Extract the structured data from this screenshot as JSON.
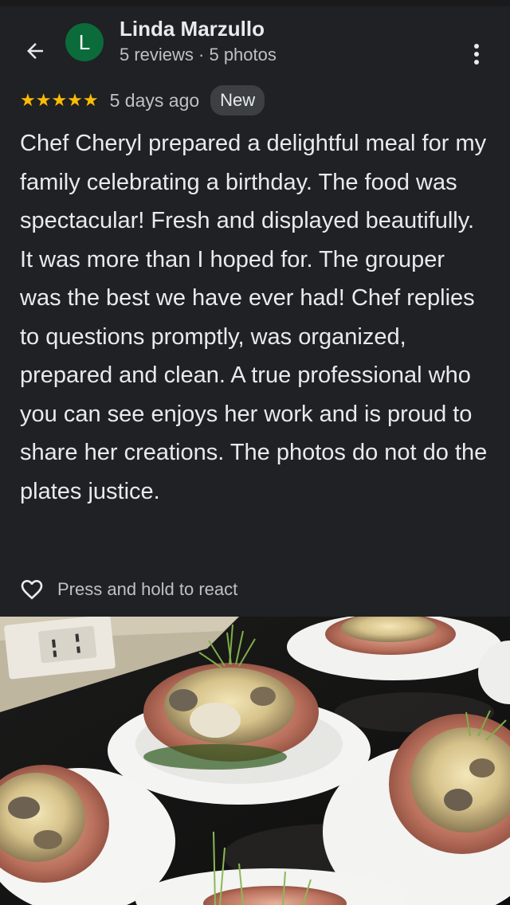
{
  "reviewer": {
    "avatar_letter": "L",
    "name": "Linda Marzullo",
    "meta": "5 reviews · 5 photos"
  },
  "review": {
    "stars": "★★★★★",
    "rating": 5,
    "time_ago": "5 days ago",
    "badge": "New",
    "text": "Chef Cheryl prepared a delightful meal for my family celebrating a birthday. The food was spectacular! Fresh and displayed beautifully. It was more than I hoped for. The grouper was the best we have ever had! Chef replies to questions promptly, was organized, prepared and clean. A true professional who you can see enjoys her work and is proud to share her creations. The photos do not do the plates justice."
  },
  "react": {
    "label": "Press and hold to react"
  },
  "icons": {
    "back": "arrow-back-icon",
    "more": "more-vert-icon",
    "react": "heart-outline-icon"
  },
  "colors": {
    "background": "#202124",
    "avatar": "#0b6b3a",
    "star": "#fbbc04",
    "badge_bg": "#3c4043"
  }
}
